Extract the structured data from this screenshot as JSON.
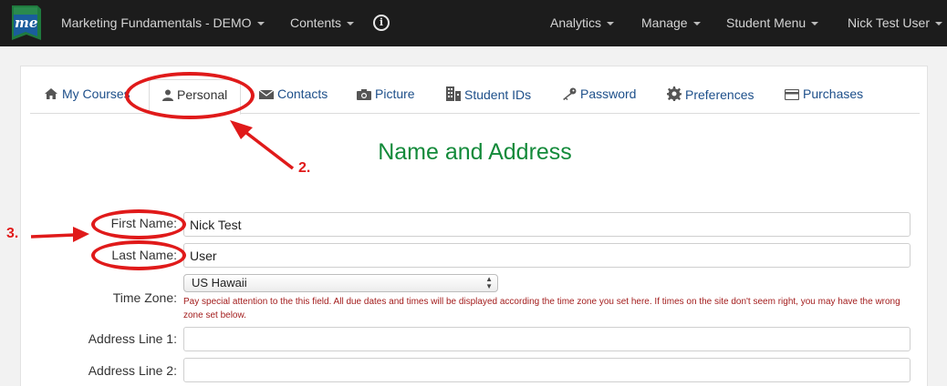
{
  "navbar": {
    "course_title": "Marketing Fundamentals - DEMO",
    "contents": "Contents",
    "analytics": "Analytics",
    "manage": "Manage",
    "student_menu": "Student Menu",
    "user": "Nick Test User",
    "logo_text": "me"
  },
  "tabs": [
    {
      "label": "My Courses",
      "icon": "home-icon"
    },
    {
      "label": "Personal",
      "icon": "person-icon",
      "active": true
    },
    {
      "label": "Contacts",
      "icon": "envelope-icon"
    },
    {
      "label": "Picture",
      "icon": "camera-icon"
    },
    {
      "label": "Student IDs",
      "icon": "building-icon"
    },
    {
      "label": "Password",
      "icon": "key-icon"
    },
    {
      "label": "Preferences",
      "icon": "gear-icon"
    },
    {
      "label": "Purchases",
      "icon": "credit-card-icon"
    }
  ],
  "heading": "Name and Address",
  "form": {
    "first_name_label": "First Name:",
    "first_name_value": "Nick Test",
    "last_name_label": "Last Name:",
    "last_name_value": "User",
    "time_zone_label": "Time Zone:",
    "time_zone_value": "US Hawaii",
    "time_zone_note": "Pay special attention to the this field. All due dates and times will be displayed according the time zone you set here. If times on the site don't seem right, you may have the wrong zone set below.",
    "address1_label": "Address Line 1:",
    "address1_value": "",
    "address2_label": "Address Line 2:",
    "address2_value": ""
  },
  "annotations": {
    "step2": "2.",
    "step3": "3.",
    "color": "#e01a1a"
  }
}
